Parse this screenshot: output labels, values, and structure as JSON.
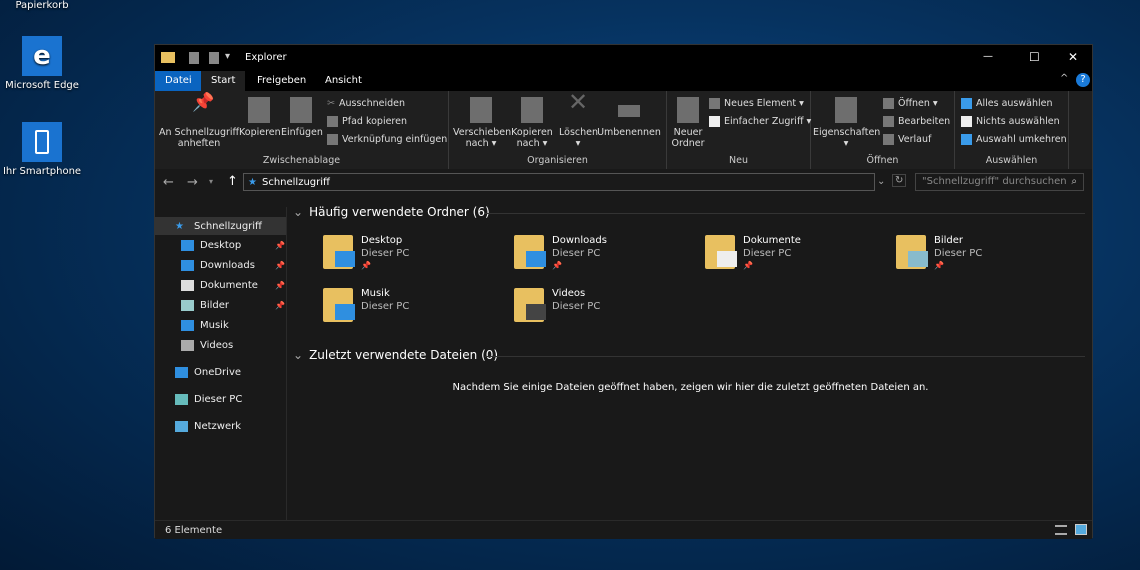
{
  "desktop": {
    "icons": [
      {
        "label": "Papierkorb"
      },
      {
        "label": "Microsoft Edge"
      },
      {
        "label": "Ihr Smartphone"
      }
    ]
  },
  "window": {
    "title": "Explorer",
    "controls": {
      "minimize": "—",
      "maximize": "☐",
      "close": "✕"
    }
  },
  "ribbon": {
    "tabs": [
      {
        "label": "Datei"
      },
      {
        "label": "Start"
      },
      {
        "label": "Freigeben"
      },
      {
        "label": "Ansicht"
      }
    ],
    "groups": {
      "clipboard": {
        "label": "Zwischenablage",
        "pin": "An Schnellzugriff\nanheften",
        "copy": "Kopieren",
        "paste": "Einfügen",
        "cut": "Ausschneiden",
        "copy_path": "Pfad kopieren",
        "paste_shortcut": "Verknüpfung einfügen"
      },
      "organize": {
        "label": "Organisieren",
        "move": "Verschieben\nnach ▾",
        "copy_to": "Kopieren\nnach ▾",
        "delete": "Löschen\n▾",
        "rename": "Umbenennen"
      },
      "new": {
        "label": "Neu",
        "new_folder": "Neuer\nOrdner",
        "new_item": "Neues Element ▾",
        "easy_access": "Einfacher Zugriff ▾"
      },
      "open": {
        "label": "Öffnen",
        "properties": "Eigenschaften\n▾",
        "open": "Öffnen ▾",
        "edit": "Bearbeiten",
        "history": "Verlauf"
      },
      "select": {
        "label": "Auswählen",
        "all": "Alles auswählen",
        "none": "Nichts auswählen",
        "invert": "Auswahl umkehren"
      }
    }
  },
  "address": {
    "path": "Schnellzugriff",
    "search_placeholder": "\"Schnellzugriff\" durchsuchen"
  },
  "sidebar": {
    "items": [
      {
        "label": "Schnellzugriff",
        "icon": "star-icon",
        "color": "#3a9bea"
      },
      {
        "label": "Desktop",
        "icon": "desktop-icon",
        "color": "#2f8fe0",
        "pinned": true
      },
      {
        "label": "Downloads",
        "icon": "download-icon",
        "color": "#2f8fe0",
        "pinned": true
      },
      {
        "label": "Dokumente",
        "icon": "document-icon",
        "color": "#ddd",
        "pinned": true
      },
      {
        "label": "Bilder",
        "icon": "pictures-icon",
        "color": "#9cc",
        "pinned": true
      },
      {
        "label": "Musik",
        "icon": "music-icon",
        "color": "#2f8fe0"
      },
      {
        "label": "Videos",
        "icon": "video-icon",
        "color": "#aaa"
      },
      {
        "label": "OneDrive",
        "icon": "cloud-icon",
        "color": "#2f8fe0"
      },
      {
        "label": "Dieser PC",
        "icon": "computer-icon",
        "color": "#6bb"
      },
      {
        "label": "Netzwerk",
        "icon": "network-icon",
        "color": "#5ad"
      }
    ]
  },
  "main": {
    "frequent": {
      "title": "Häufig verwendete Ordner (6)",
      "folders": [
        {
          "name": "Desktop",
          "location": "Dieser PC",
          "pinned": true,
          "accent": "#2f8fe0"
        },
        {
          "name": "Downloads",
          "location": "Dieser PC",
          "pinned": true,
          "accent": "#2f8fe0"
        },
        {
          "name": "Dokumente",
          "location": "Dieser PC",
          "pinned": true,
          "accent": "#eee"
        },
        {
          "name": "Bilder",
          "location": "Dieser PC",
          "pinned": true,
          "accent": "#8bc"
        },
        {
          "name": "Musik",
          "location": "Dieser PC",
          "pinned": false,
          "accent": "#2f8fe0"
        },
        {
          "name": "Videos",
          "location": "Dieser PC",
          "pinned": false,
          "accent": "#444"
        }
      ]
    },
    "recent": {
      "title": "Zuletzt verwendete Dateien (0)",
      "empty_message": "Nachdem Sie einige Dateien geöffnet haben, zeigen wir hier die zuletzt geöffneten Dateien an."
    }
  },
  "status": {
    "count": "6 Elemente"
  },
  "colors": {
    "accent": "#0a64c0"
  }
}
